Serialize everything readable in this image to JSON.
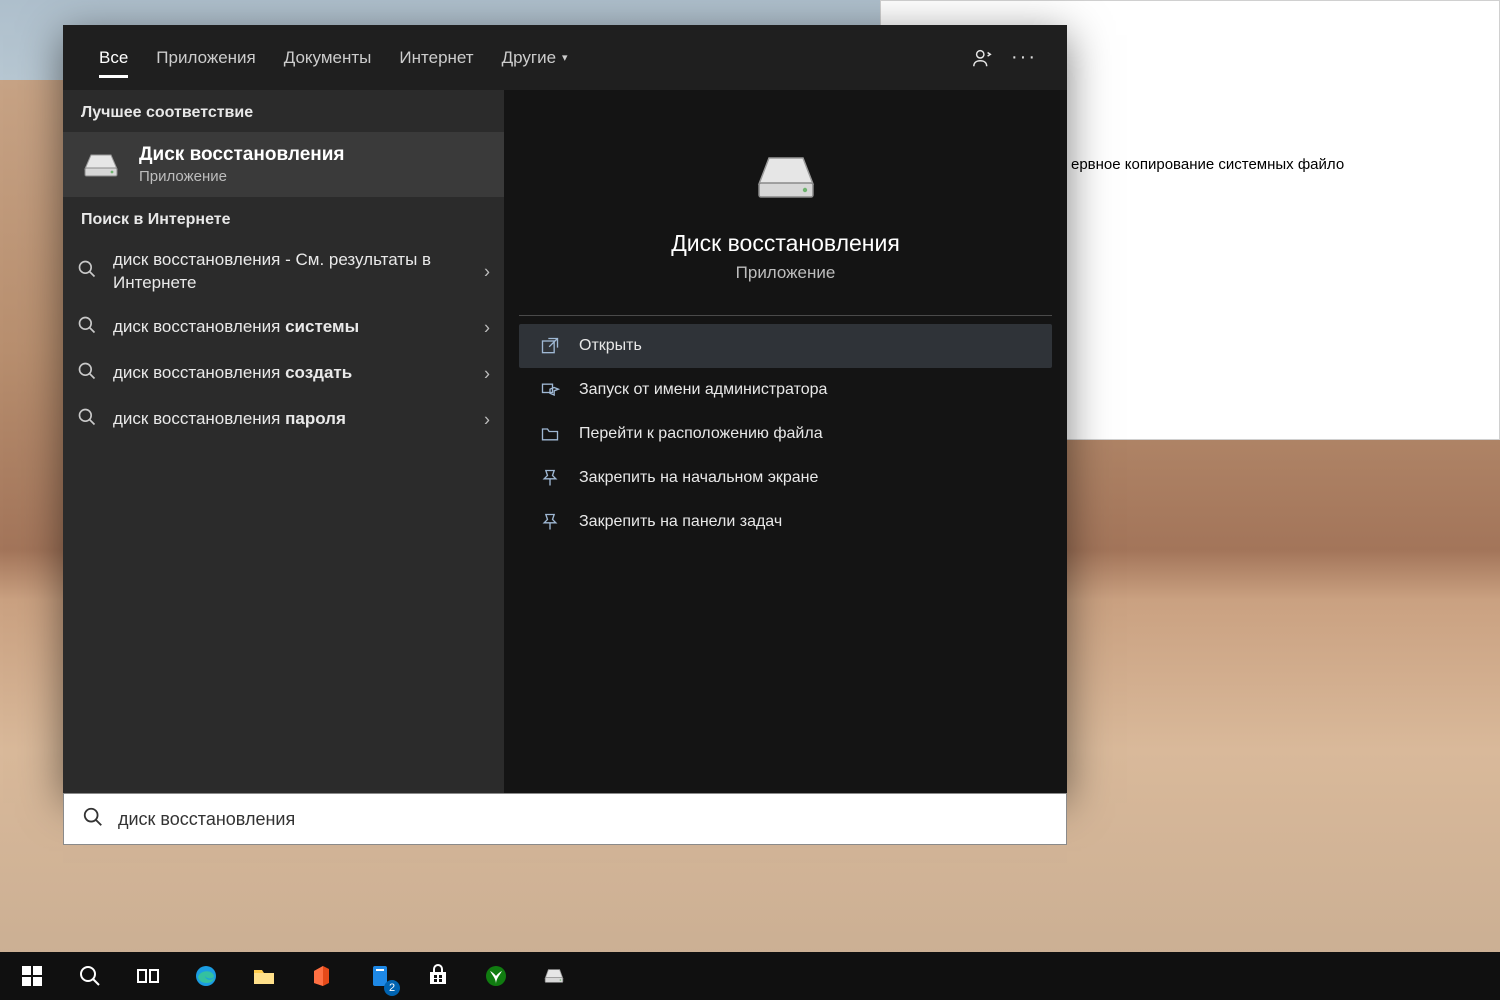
{
  "bg_window": {
    "text": "ервное копирование системных файло"
  },
  "tabs": {
    "all": "Все",
    "apps": "Приложения",
    "docs": "Документы",
    "web": "Интернет",
    "more": "Другие"
  },
  "left": {
    "best_label": "Лучшее соответствие",
    "best_match": {
      "title": "Диск восстановления",
      "subtitle": "Приложение"
    },
    "web_label": "Поиск в Интернете",
    "items": [
      {
        "prefix": "диск восстановления",
        "suffix": " - См. результаты в Интернете",
        "bold": ""
      },
      {
        "prefix": "диск восстановления ",
        "bold": "системы",
        "suffix": ""
      },
      {
        "prefix": "диск восстановления ",
        "bold": "создать",
        "suffix": ""
      },
      {
        "prefix": "диск восстановления ",
        "bold": "пароля",
        "suffix": ""
      }
    ]
  },
  "right": {
    "title": "Диск восстановления",
    "subtitle": "Приложение",
    "actions": [
      {
        "label": "Открыть",
        "selected": true,
        "icon": "open"
      },
      {
        "label": "Запуск от имени администратора",
        "selected": false,
        "icon": "shield"
      },
      {
        "label": "Перейти к расположению файла",
        "selected": false,
        "icon": "folder"
      },
      {
        "label": "Закрепить на начальном экране",
        "selected": false,
        "icon": "pin"
      },
      {
        "label": "Закрепить на панели задач",
        "selected": false,
        "icon": "pin"
      }
    ]
  },
  "search": {
    "value": "диск восстановления"
  },
  "taskbar": {
    "tips_badge": "2"
  }
}
